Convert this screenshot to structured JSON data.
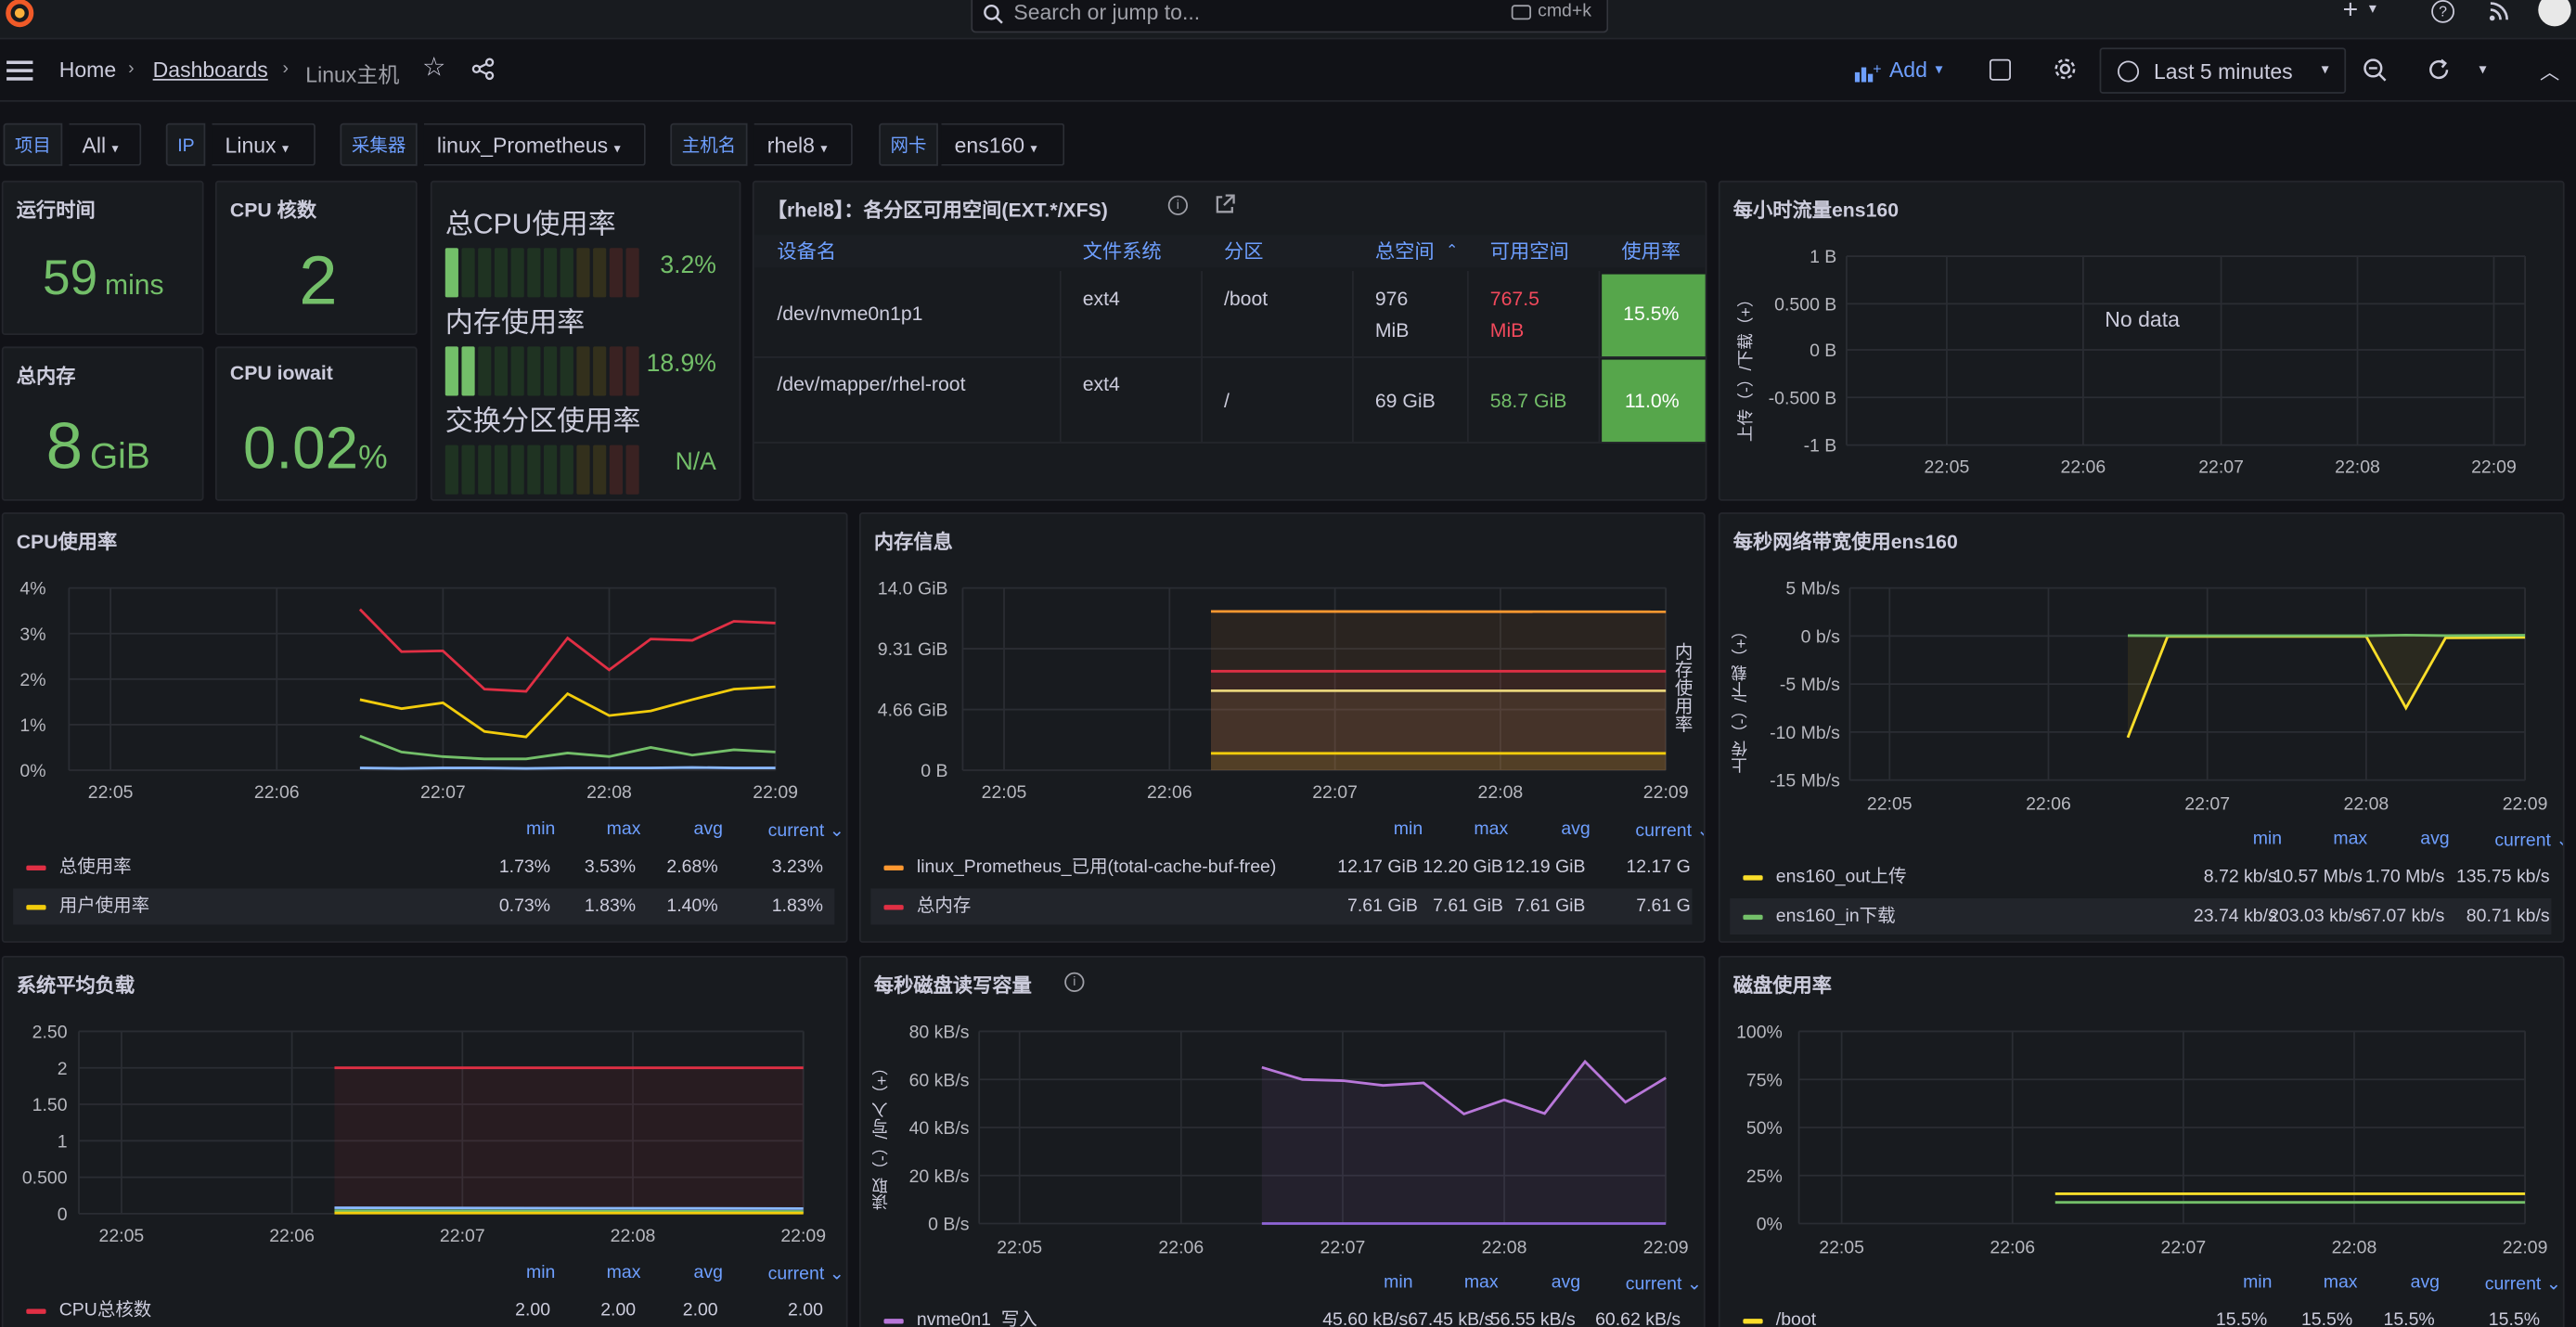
{
  "topbar": {
    "search_placeholder": "Search or jump to...",
    "shortcut": "cmd+k",
    "add_symbol": "+"
  },
  "navbar": {
    "breadcrumb": [
      "Home",
      "Dashboards",
      "Linux主机"
    ],
    "add_label": "Add",
    "time_range": "Last 5 minutes"
  },
  "variables": [
    {
      "label": "项目",
      "value": "All"
    },
    {
      "label": "IP",
      "value": "Linux"
    },
    {
      "label": "采集器",
      "value": "linux_Prometheus"
    },
    {
      "label": "主机名",
      "value": "rhel8"
    },
    {
      "label": "网卡",
      "value": "ens160"
    }
  ],
  "stats": {
    "uptime": {
      "title": "运行时间",
      "value": "59",
      "unit": "mins"
    },
    "cpu_cores": {
      "title": "CPU 核数",
      "value": "2"
    },
    "total_mem": {
      "title": "总内存",
      "value": "8",
      "unit": "GiB"
    },
    "iowait": {
      "title": "CPU iowait",
      "value": "0.02",
      "unit": "%"
    }
  },
  "gauges": [
    {
      "label": "总CPU使用率",
      "value": "3.2%",
      "level": 0.032
    },
    {
      "label": "内存使用率",
      "value": "18.9%",
      "level": 0.189
    },
    {
      "label": "交换分区使用率",
      "value": "N/A",
      "level": 0
    }
  ],
  "partition_table": {
    "title": "【rhel8】：各分区可用空间(EXT.*/XFS)",
    "headers": [
      "设备名",
      "文件系统",
      "分区",
      "总空间",
      "可用空间",
      "使用率"
    ],
    "rows": [
      {
        "device": "/dev/nvme0n1p1",
        "fs": "ext4",
        "mount": "/boot",
        "total": "976 MiB",
        "total1": "976",
        "total2": "MiB",
        "avail1": "767.5",
        "avail2": "MiB",
        "usage": "15.5%"
      },
      {
        "device": "/dev/mapper/rhel-root",
        "fs": "ext4",
        "mount": "/",
        "total1": "69 GiB",
        "avail1": "58.7 GiB",
        "usage": "11.0%"
      }
    ],
    "colors": {
      "usage_bg": "#56a64b",
      "avail_red": "#f2495c",
      "avail_green": "#73bf69"
    }
  },
  "hourly_traffic": {
    "title": "每小时流量ens160",
    "ylabel": "上传（-）/下载（+）",
    "no_data": "No data",
    "yticks": [
      "1 B",
      "0.500 B",
      "0 B",
      "-0.500 B",
      "-1 B"
    ],
    "xticks": [
      "22:05",
      "22:06",
      "22:07",
      "22:08",
      "22:09"
    ]
  },
  "cpu_panel": {
    "title": "CPU使用率",
    "legend_headers": [
      "min",
      "max",
      "avg",
      "current"
    ],
    "legend": [
      {
        "name": "总使用率",
        "color": "#e02f44",
        "min": "1.73%",
        "max": "3.53%",
        "avg": "2.68%",
        "current": "3.23%"
      },
      {
        "name": "用户使用率",
        "color": "#f2cc0c",
        "min": "0.73%",
        "max": "1.83%",
        "avg": "1.40%",
        "current": "1.83%"
      }
    ]
  },
  "mem_panel": {
    "title": "内存信息",
    "right_label": "内存使用率",
    "legend_headers": [
      "min",
      "max",
      "avg",
      "current"
    ],
    "legend": [
      {
        "name": "linux_Prometheus_已用(total-cache-buf-free)",
        "color": "#ff9830",
        "min": "12.17 GiB",
        "max": "12.20 GiB",
        "avg": "12.19 GiB",
        "current": "12.17 G"
      },
      {
        "name": "总内存",
        "color": "#e02f44",
        "min": "7.61 GiB",
        "max": "7.61 GiB",
        "avg": "7.61 GiB",
        "current": "7.61 G"
      }
    ]
  },
  "net_panel": {
    "title": "每秒网络带宽使用ens160",
    "ylabel": "上传（-）/下载（+）",
    "legend_headers": [
      "min",
      "max",
      "avg",
      "current"
    ],
    "legend": [
      {
        "name": "ens160_out上传",
        "color": "#fade2a",
        "min": "8.72 kb/s",
        "max": "10.57 Mb/s",
        "avg": "1.70 Mb/s",
        "current": "135.75 kb/s"
      },
      {
        "name": "ens160_in下载",
        "color": "#73bf69",
        "min": "23.74 kb/s",
        "max": "203.03 kb/s",
        "avg": "67.07 kb/s",
        "current": "80.71 kb/s"
      }
    ]
  },
  "load_panel": {
    "title": "系统平均负载",
    "legend_headers": [
      "min",
      "max",
      "avg",
      "current"
    ],
    "legend": [
      {
        "name": "CPU总核数",
        "color": "#e02f44",
        "min": "2.00",
        "max": "2.00",
        "avg": "2.00",
        "current": "2.00"
      }
    ]
  },
  "disk_io_panel": {
    "title": "每秒磁盘读写容量",
    "ylabel": "读取（-）/写入（+）",
    "legend_headers": [
      "min",
      "max",
      "avg",
      "current"
    ],
    "legend": [
      {
        "name": "nvme0n1_写入",
        "color": "#b877d9",
        "min": "45.60 kB/s",
        "max": "67.45 kB/s",
        "avg": "56.55 kB/s",
        "current": "60.62 kB/s"
      }
    ]
  },
  "disk_usage_panel": {
    "title": "磁盘使用率",
    "legend_headers": [
      "min",
      "max",
      "avg",
      "current"
    ],
    "legend": [
      {
        "name": "/boot",
        "color": "#fade2a",
        "min": "15.5%",
        "max": "15.5%",
        "avg": "15.5%",
        "current": "15.5%"
      }
    ]
  },
  "chart_data": [
    {
      "type": "line",
      "title": "CPU使用率",
      "yticks": [
        "4%",
        "3%",
        "2%",
        "1%",
        "0%"
      ],
      "ylim": [
        0,
        4
      ],
      "xticks": [
        "22:05",
        "22:06",
        "22:07",
        "22:08",
        "22:09"
      ],
      "x": [
        "22:06:30",
        "22:06:45",
        "22:07:00",
        "22:07:15",
        "22:07:30",
        "22:07:45",
        "22:08:00",
        "22:08:15",
        "22:08:30",
        "22:08:45",
        "22:09:00"
      ],
      "series": [
        {
          "name": "总使用率",
          "color": "#e02f44",
          "values": [
            3.53,
            2.6,
            2.62,
            1.78,
            1.73,
            2.9,
            2.2,
            2.88,
            2.85,
            3.27,
            3.23
          ]
        },
        {
          "name": "用户使用率",
          "color": "#f2cc0c",
          "values": [
            1.55,
            1.35,
            1.48,
            0.85,
            0.73,
            1.68,
            1.2,
            1.3,
            1.55,
            1.78,
            1.83
          ]
        },
        {
          "color": "#73bf69",
          "values": [
            0.75,
            0.4,
            0.3,
            0.25,
            0.25,
            0.38,
            0.3,
            0.5,
            0.33,
            0.45,
            0.4
          ]
        },
        {
          "color": "#8ab8ff",
          "values": [
            0.05,
            0.04,
            0.05,
            0.05,
            0.04,
            0.05,
            0.05,
            0.05,
            0.06,
            0.05,
            0.05
          ]
        }
      ]
    },
    {
      "type": "line",
      "title": "内存信息",
      "yticks": [
        "14.0 GiB",
        "9.31 GiB",
        "4.66 GiB",
        "0 B"
      ],
      "ylim": [
        0,
        14
      ],
      "xticks": [
        "22:05",
        "22:06",
        "22:07",
        "22:08",
        "22:09"
      ],
      "x": [
        "22:06:15",
        "22:09:00"
      ],
      "series": [
        {
          "name": "linux_Prometheus_已用(total-cache-buf-free)",
          "color": "#ff9830",
          "values": [
            12.2,
            12.17
          ]
        },
        {
          "name": "总内存",
          "color": "#e02f44",
          "values": [
            7.61,
            7.61
          ]
        },
        {
          "color": "#e8d37a",
          "values": [
            6.1,
            6.1
          ]
        },
        {
          "color": "#f2cc0c",
          "values": [
            1.3,
            1.3
          ]
        }
      ]
    },
    {
      "type": "line",
      "title": "每秒网络带宽使用ens160",
      "yticks": [
        "5 Mb/s",
        "0 b/s",
        "-5 Mb/s",
        "-10 Mb/s",
        "-15 Mb/s"
      ],
      "ylim": [
        -15,
        5
      ],
      "xticks": [
        "22:05",
        "22:06",
        "22:07",
        "22:08",
        "22:09"
      ],
      "x": [
        "22:06:30",
        "22:06:45",
        "22:07:00",
        "22:07:30",
        "22:08:00",
        "22:08:15",
        "22:08:30",
        "22:09:00"
      ],
      "series": [
        {
          "name": "ens160_out上传",
          "color": "#fade2a",
          "values": [
            -10.57,
            -0.05,
            -0.05,
            -0.05,
            -0.05,
            -7.5,
            -0.2,
            -0.14
          ]
        },
        {
          "name": "ens160_in下载",
          "color": "#73bf69",
          "values": [
            0.05,
            0.02,
            0.03,
            0.02,
            0.03,
            0.1,
            0.05,
            0.08
          ]
        }
      ]
    },
    {
      "type": "line",
      "title": "系统平均负载",
      "yticks": [
        "2.50",
        "2",
        "1.50",
        "1",
        "0.500",
        "0"
      ],
      "ylim": [
        0,
        2.5
      ],
      "xticks": [
        "22:05",
        "22:06",
        "22:07",
        "22:08",
        "22:09"
      ],
      "x": [
        "22:06:15",
        "22:09:00"
      ],
      "series": [
        {
          "name": "CPU总核数",
          "color": "#e02f44",
          "values": [
            2.0,
            2.0
          ]
        },
        {
          "color": "#8ab8ff",
          "values": [
            0.08,
            0.07
          ]
        },
        {
          "color": "#73bf69",
          "values": [
            0.04,
            0.03
          ]
        },
        {
          "color": "#f2cc0c",
          "values": [
            0.01,
            0.01
          ]
        }
      ]
    },
    {
      "type": "line",
      "title": "每秒磁盘读写容量",
      "yticks": [
        "80 kB/s",
        "60 kB/s",
        "40 kB/s",
        "20 kB/s",
        "0 B/s"
      ],
      "ylim": [
        0,
        80
      ],
      "xticks": [
        "22:05",
        "22:06",
        "22:07",
        "22:08",
        "22:09"
      ],
      "x": [
        "22:06:30",
        "22:06:45",
        "22:07:00",
        "22:07:15",
        "22:07:30",
        "22:07:45",
        "22:08:00",
        "22:08:15",
        "22:08:30",
        "22:08:45",
        "22:09:00"
      ],
      "series": [
        {
          "name": "nvme0n1_写入",
          "color": "#b877d9",
          "values": [
            65,
            60,
            59.5,
            57.5,
            58.5,
            45.6,
            51.5,
            45.8,
            67.45,
            50.5,
            60.62
          ]
        },
        {
          "color": "#8f66d8",
          "values": [
            0,
            0,
            0,
            0,
            0,
            0,
            0,
            0,
            0,
            0,
            0
          ]
        }
      ]
    },
    {
      "type": "line",
      "title": "磁盘使用率",
      "yticks": [
        "100%",
        "75%",
        "50%",
        "25%",
        "0%"
      ],
      "ylim": [
        0,
        100
      ],
      "xticks": [
        "22:05",
        "22:06",
        "22:07",
        "22:08",
        "22:09"
      ],
      "x": [
        "22:06:15",
        "22:09:00"
      ],
      "series": [
        {
          "name": "/boot",
          "color": "#fade2a",
          "values": [
            15.5,
            15.5
          ]
        },
        {
          "color": "#73bf69",
          "values": [
            11.0,
            11.0
          ]
        }
      ]
    }
  ]
}
